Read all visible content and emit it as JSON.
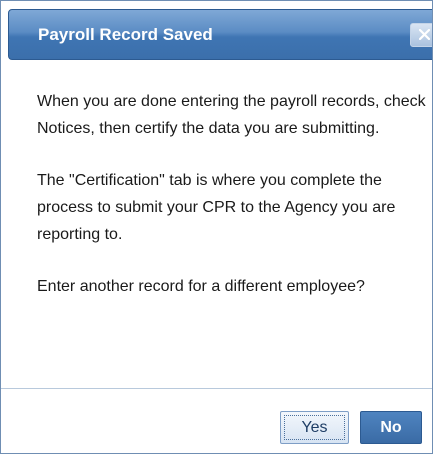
{
  "dialog": {
    "title": "Payroll Record Saved",
    "close_icon": "close-icon",
    "paragraphs": {
      "p1": "When you are done entering the payroll records, check Notices, then certify the data you are submitting.",
      "p2": "The \"Certification\" tab is where you complete the process to submit your CPR to the Agency you are reporting to.",
      "p3": "Enter another record for a different employee?"
    },
    "buttons": {
      "yes_label": "Yes",
      "no_label": "No"
    }
  },
  "colors": {
    "titlebar": "#3f75b3",
    "title_text": "#ffffff",
    "border": "#6f8eb3",
    "primary_button": "#3a6ba5"
  }
}
